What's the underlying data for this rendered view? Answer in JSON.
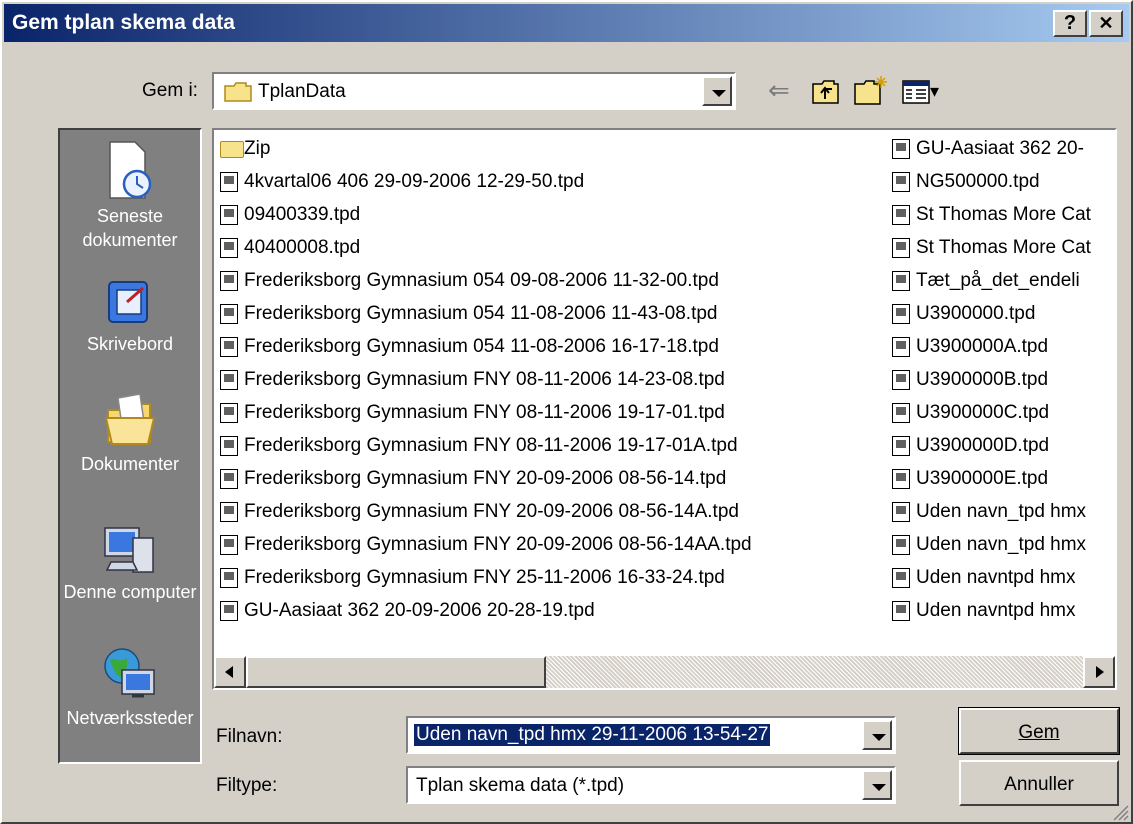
{
  "window": {
    "title": "Gem tplan skema data",
    "help_label": "?",
    "close_label": "✕"
  },
  "save_in": {
    "label": "Gem i:",
    "folder": "TplanData"
  },
  "toolbar": {
    "back_glyph": "⇐",
    "view_menu_arrow": "▾"
  },
  "places": [
    {
      "label": "Seneste dokumenter",
      "icon": "recent-documents-icon"
    },
    {
      "label": "Skrivebord",
      "icon": "desktop-icon"
    },
    {
      "label": "Dokumenter",
      "icon": "documents-folder-icon"
    },
    {
      "label": "Denne computer",
      "icon": "computer-icon"
    },
    {
      "label": "Netværkssteder",
      "icon": "network-icon"
    }
  ],
  "files_col1": [
    {
      "name": "Zip",
      "type": "folder"
    },
    {
      "name": "4kvartal06 406 29-09-2006 12-29-50.tpd",
      "type": "file"
    },
    {
      "name": "09400339.tpd",
      "type": "file"
    },
    {
      "name": "40400008.tpd",
      "type": "file"
    },
    {
      "name": "Frederiksborg Gymnasium 054 09-08-2006 11-32-00.tpd",
      "type": "file"
    },
    {
      "name": "Frederiksborg Gymnasium 054 11-08-2006 11-43-08.tpd",
      "type": "file"
    },
    {
      "name": "Frederiksborg Gymnasium 054 11-08-2006 16-17-18.tpd",
      "type": "file"
    },
    {
      "name": "Frederiksborg Gymnasium FNY 08-11-2006 14-23-08.tpd",
      "type": "file"
    },
    {
      "name": "Frederiksborg Gymnasium FNY 08-11-2006 19-17-01.tpd",
      "type": "file"
    },
    {
      "name": "Frederiksborg Gymnasium FNY 08-11-2006 19-17-01A.tpd",
      "type": "file"
    },
    {
      "name": "Frederiksborg Gymnasium FNY 20-09-2006 08-56-14.tpd",
      "type": "file"
    },
    {
      "name": "Frederiksborg Gymnasium FNY 20-09-2006 08-56-14A.tpd",
      "type": "file"
    },
    {
      "name": "Frederiksborg Gymnasium FNY 20-09-2006 08-56-14AA.tpd",
      "type": "file"
    },
    {
      "name": "Frederiksborg Gymnasium FNY 25-11-2006 16-33-24.tpd",
      "type": "file"
    },
    {
      "name": "GU-Aasiaat 362 20-09-2006 20-28-19.tpd",
      "type": "file"
    }
  ],
  "files_col2": [
    {
      "name": "GU-Aasiaat 362 20-",
      "type": "file"
    },
    {
      "name": "NG500000.tpd",
      "type": "file"
    },
    {
      "name": "St Thomas More Cat",
      "type": "file"
    },
    {
      "name": "St Thomas More Cat",
      "type": "file"
    },
    {
      "name": "Tæt_på_det_endeli",
      "type": "file"
    },
    {
      "name": "U3900000.tpd",
      "type": "file"
    },
    {
      "name": "U3900000A.tpd",
      "type": "file"
    },
    {
      "name": "U3900000B.tpd",
      "type": "file"
    },
    {
      "name": "U3900000C.tpd",
      "type": "file"
    },
    {
      "name": "U3900000D.tpd",
      "type": "file"
    },
    {
      "name": "U3900000E.tpd",
      "type": "file"
    },
    {
      "name": "Uden navn_tpd hmx",
      "type": "file"
    },
    {
      "name": "Uden navn_tpd hmx",
      "type": "file"
    },
    {
      "name": "Uden navntpd hmx",
      "type": "file"
    },
    {
      "name": "Uden navntpd hmx",
      "type": "file"
    }
  ],
  "filename": {
    "label": "Filnavn:",
    "value": "Uden navn_tpd hmx 29-11-2006 13-54-27"
  },
  "filetype": {
    "label": "Filtype:",
    "value": "Tplan skema data (*.tpd)"
  },
  "buttons": {
    "save": "Gem",
    "cancel": "Annuller"
  },
  "colors": {
    "titlebar_start": "#0a246a",
    "titlebar_end": "#a6caf0",
    "selection": "#0a246a",
    "face": "#d4d0c8",
    "places_bg": "#808080"
  }
}
